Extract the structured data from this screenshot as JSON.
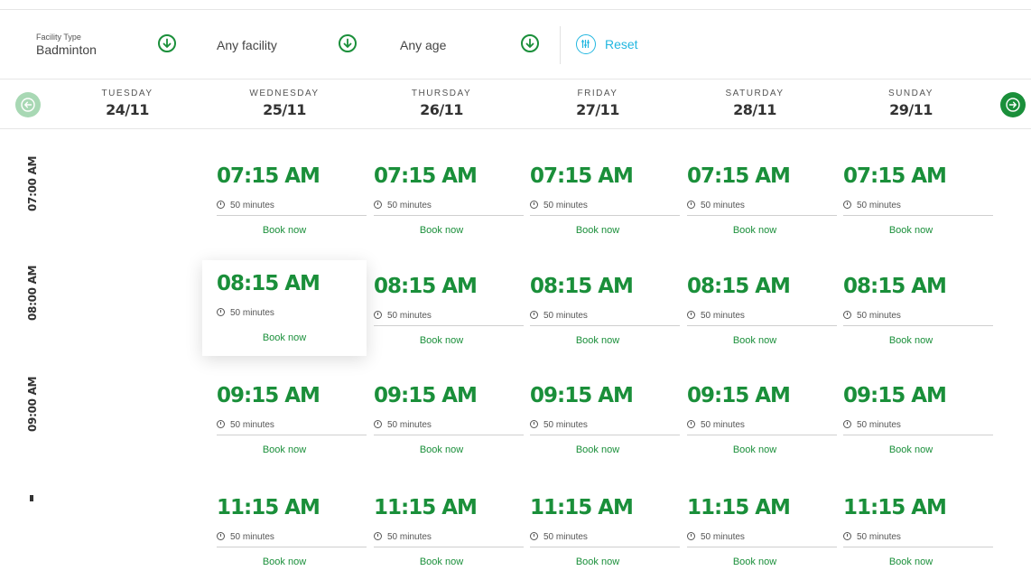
{
  "filters": {
    "facility_type_label": "Facility Type",
    "facility_type_value": "Badminton",
    "facility_value": "Any facility",
    "age_value": "Any age",
    "reset_label": "Reset"
  },
  "days": [
    {
      "name": "TUESDAY",
      "date": "24/11"
    },
    {
      "name": "WEDNESDAY",
      "date": "25/11"
    },
    {
      "name": "THURSDAY",
      "date": "26/11"
    },
    {
      "name": "FRIDAY",
      "date": "27/11"
    },
    {
      "name": "SATURDAY",
      "date": "28/11"
    },
    {
      "name": "SUNDAY",
      "date": "29/11"
    }
  ],
  "rows": [
    {
      "label": "07:00 AM",
      "time": "07:15 AM"
    },
    {
      "label": "08:00 AM",
      "time": "08:15 AM"
    },
    {
      "label": "09:00 AM",
      "time": "09:15 AM"
    },
    {
      "label": "",
      "time": "11:15 AM"
    }
  ],
  "slot_duration": "50 minutes",
  "book_label": "Book now",
  "colors": {
    "accent": "#1a8f3a",
    "reset": "#22b7e0",
    "nav_disabled": "#a8d8b4"
  },
  "icons": {
    "dropdown": "arrow-down-circle-icon",
    "reset": "sliders-icon",
    "prev": "arrow-left-circle-icon",
    "next": "arrow-right-circle-icon",
    "duration": "clock-icon"
  }
}
